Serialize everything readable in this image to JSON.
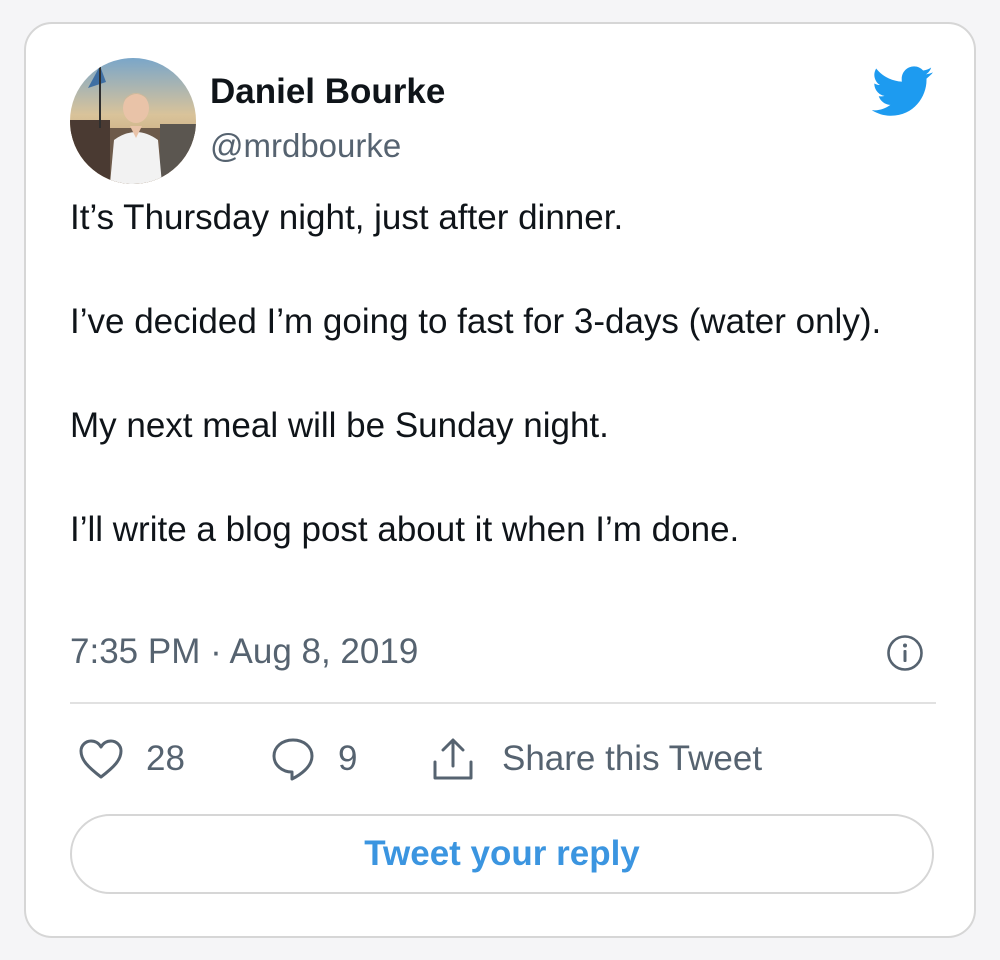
{
  "author": {
    "name": "Daniel Bourke",
    "handle": "@mrdbourke"
  },
  "tweet": {
    "paragraphs": [
      "It’s Thursday night, just after dinner.",
      "I’ve decided I’m going to fast for 3-days (water only).",
      "My next meal will be Sunday night.",
      "I’ll write a blog post about it when I’m done."
    ],
    "timestamp": "7:35 PM · Aug 8, 2019"
  },
  "actions": {
    "likes": "28",
    "replies": "9",
    "share_label": "Share this Tweet"
  },
  "reply_button_label": "Tweet your reply",
  "icons": {
    "brand": "twitter-bird-icon",
    "info": "info-icon",
    "like": "heart-icon",
    "reply": "reply-bubble-icon",
    "share": "share-icon"
  },
  "colors": {
    "brand_blue": "#1d9bf0",
    "reply_link_blue": "#3b95e0",
    "secondary_text": "#566370",
    "border": "#d6d6d6"
  }
}
